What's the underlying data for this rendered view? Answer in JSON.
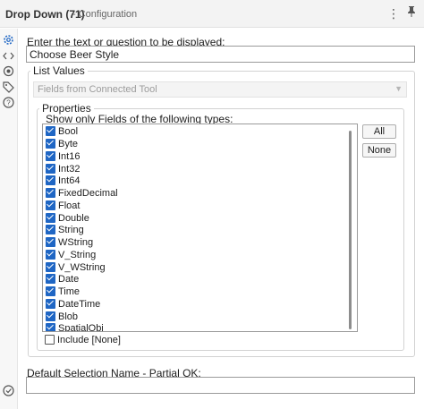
{
  "window": {
    "title": "Drop Down (71)",
    "subtitle": "- Configuration",
    "menu_icon": "⋮",
    "pin_icon": "📌"
  },
  "sidebar": {
    "icons": [
      "gear-icon",
      "code-icon",
      "target-icon",
      "tag-icon",
      "help-icon",
      "check-circle-icon"
    ]
  },
  "prompt": {
    "label": "Enter the text or question to be displayed:",
    "value": "Choose Beer Style"
  },
  "list_values": {
    "title": "List Values",
    "source": "Fields from Connected Tool",
    "properties": {
      "title": "Properties",
      "filter_label": "Show only Fields of the following types:",
      "types": [
        {
          "name": "Bool",
          "checked": true
        },
        {
          "name": "Byte",
          "checked": true
        },
        {
          "name": "Int16",
          "checked": true
        },
        {
          "name": "Int32",
          "checked": true
        },
        {
          "name": "Int64",
          "checked": true
        },
        {
          "name": "FixedDecimal",
          "checked": true
        },
        {
          "name": "Float",
          "checked": true
        },
        {
          "name": "Double",
          "checked": true
        },
        {
          "name": "String",
          "checked": true
        },
        {
          "name": "WString",
          "checked": true
        },
        {
          "name": "V_String",
          "checked": true
        },
        {
          "name": "V_WString",
          "checked": true
        },
        {
          "name": "Date",
          "checked": true
        },
        {
          "name": "Time",
          "checked": true
        },
        {
          "name": "DateTime",
          "checked": true
        },
        {
          "name": "Blob",
          "checked": true
        },
        {
          "name": "SpatialObj",
          "checked": true
        }
      ],
      "all_label": "All",
      "none_label": "None",
      "include_none_label": "Include [None]",
      "include_none_checked": false
    }
  },
  "default_selection": {
    "label": "Default Selection Name - Partial OK:",
    "value": ""
  }
}
